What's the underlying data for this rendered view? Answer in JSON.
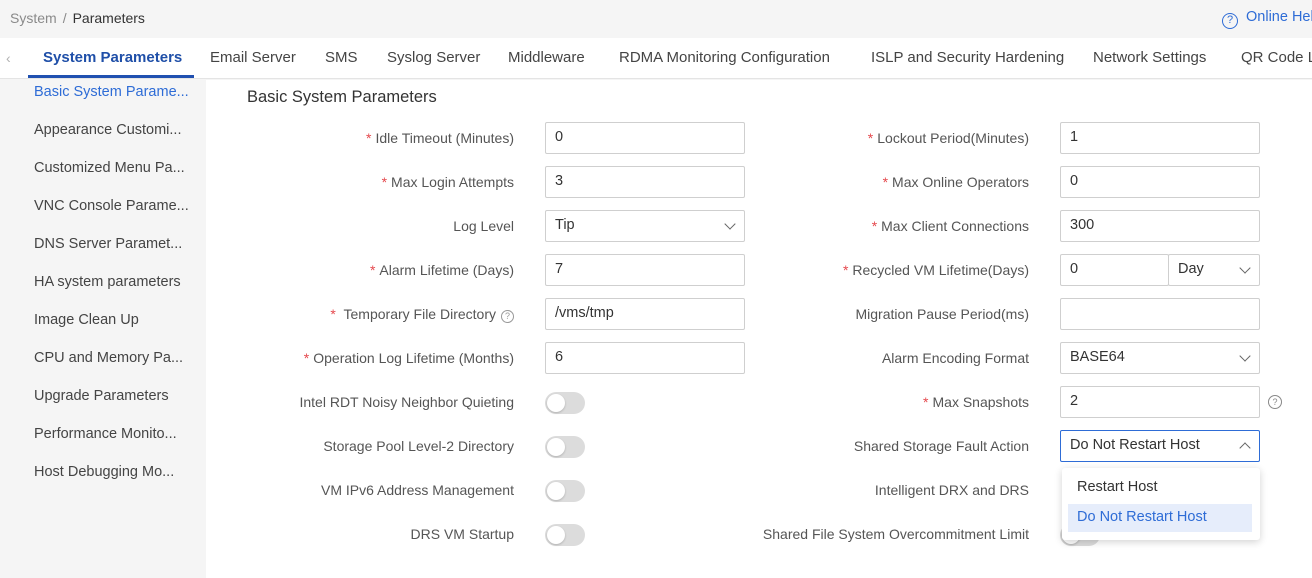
{
  "breadcrumb": {
    "parent": "System",
    "separator": "/",
    "current": "Parameters"
  },
  "help": {
    "icon": "question-circle-icon",
    "label": "Online Help"
  },
  "tabs": [
    {
      "label": "System Parameters",
      "active": true
    },
    {
      "label": "Email Server"
    },
    {
      "label": "SMS"
    },
    {
      "label": "Syslog Server"
    },
    {
      "label": "Middleware"
    },
    {
      "label": "RDMA Monitoring Configuration"
    },
    {
      "label": "ISLP and Security Hardening"
    },
    {
      "label": "Network Settings"
    },
    {
      "label": "QR Code Login"
    }
  ],
  "sidebar": {
    "items": [
      {
        "label": "Basic System Parame...",
        "active": true
      },
      {
        "label": "Appearance Customi..."
      },
      {
        "label": "Customized Menu Pa..."
      },
      {
        "label": "VNC Console Parame..."
      },
      {
        "label": "DNS Server Paramet..."
      },
      {
        "label": "HA system parameters"
      },
      {
        "label": "Image Clean Up"
      },
      {
        "label": "CPU and Memory Pa..."
      },
      {
        "label": "Upgrade Parameters"
      },
      {
        "label": "Performance Monito..."
      },
      {
        "label": "Host Debugging Mo..."
      }
    ]
  },
  "section_title": "Basic System Parameters",
  "required_mark": "*",
  "left": {
    "idle_timeout": {
      "label": "Idle Timeout (Minutes)",
      "value": "0"
    },
    "max_login": {
      "label": "Max Login Attempts",
      "value": "3"
    },
    "log_level": {
      "label": "Log Level",
      "value": "Tip"
    },
    "alarm_lifetime": {
      "label": "Alarm Lifetime (Days)",
      "value": "7"
    },
    "temp_dir": {
      "label": "Temporary File Directory",
      "value": "/vms/tmp"
    },
    "op_log": {
      "label": "Operation Log Lifetime (Months)",
      "value": "6"
    },
    "rdt": {
      "label": "Intel RDT Noisy Neighbor Quieting",
      "on": false
    },
    "storage_l2": {
      "label": "Storage Pool Level-2 Directory",
      "on": false
    },
    "ipv6": {
      "label": "VM IPv6 Address Management",
      "on": false
    },
    "drs_startup": {
      "label": "DRS VM Startup",
      "on": false
    }
  },
  "right": {
    "lockout": {
      "label": "Lockout Period(Minutes)",
      "value": "1"
    },
    "max_online": {
      "label": "Max Online Operators",
      "value": "0"
    },
    "max_client": {
      "label": "Max Client Connections",
      "value": "300"
    },
    "recycled": {
      "label": "Recycled VM Lifetime(Days)",
      "value": "0",
      "unit": "Day"
    },
    "migration": {
      "label": "Migration Pause Period(ms)",
      "value": ""
    },
    "alarm_enc": {
      "label": "Alarm Encoding Format",
      "value": "BASE64"
    },
    "max_snap": {
      "label": "Max Snapshots",
      "value": "2"
    },
    "fault": {
      "label": "Shared Storage Fault Action",
      "value": "Do Not Restart Host",
      "options": [
        "Restart Host",
        "Do Not Restart Host"
      ]
    },
    "drx": {
      "label": "Intelligent DRX and DRS"
    },
    "overcommit": {
      "label": "Shared File System Overcommitment Limit"
    }
  },
  "tip_glyph": "?",
  "colors": {
    "accent": "#2e6cd6",
    "required": "#e5484d"
  }
}
